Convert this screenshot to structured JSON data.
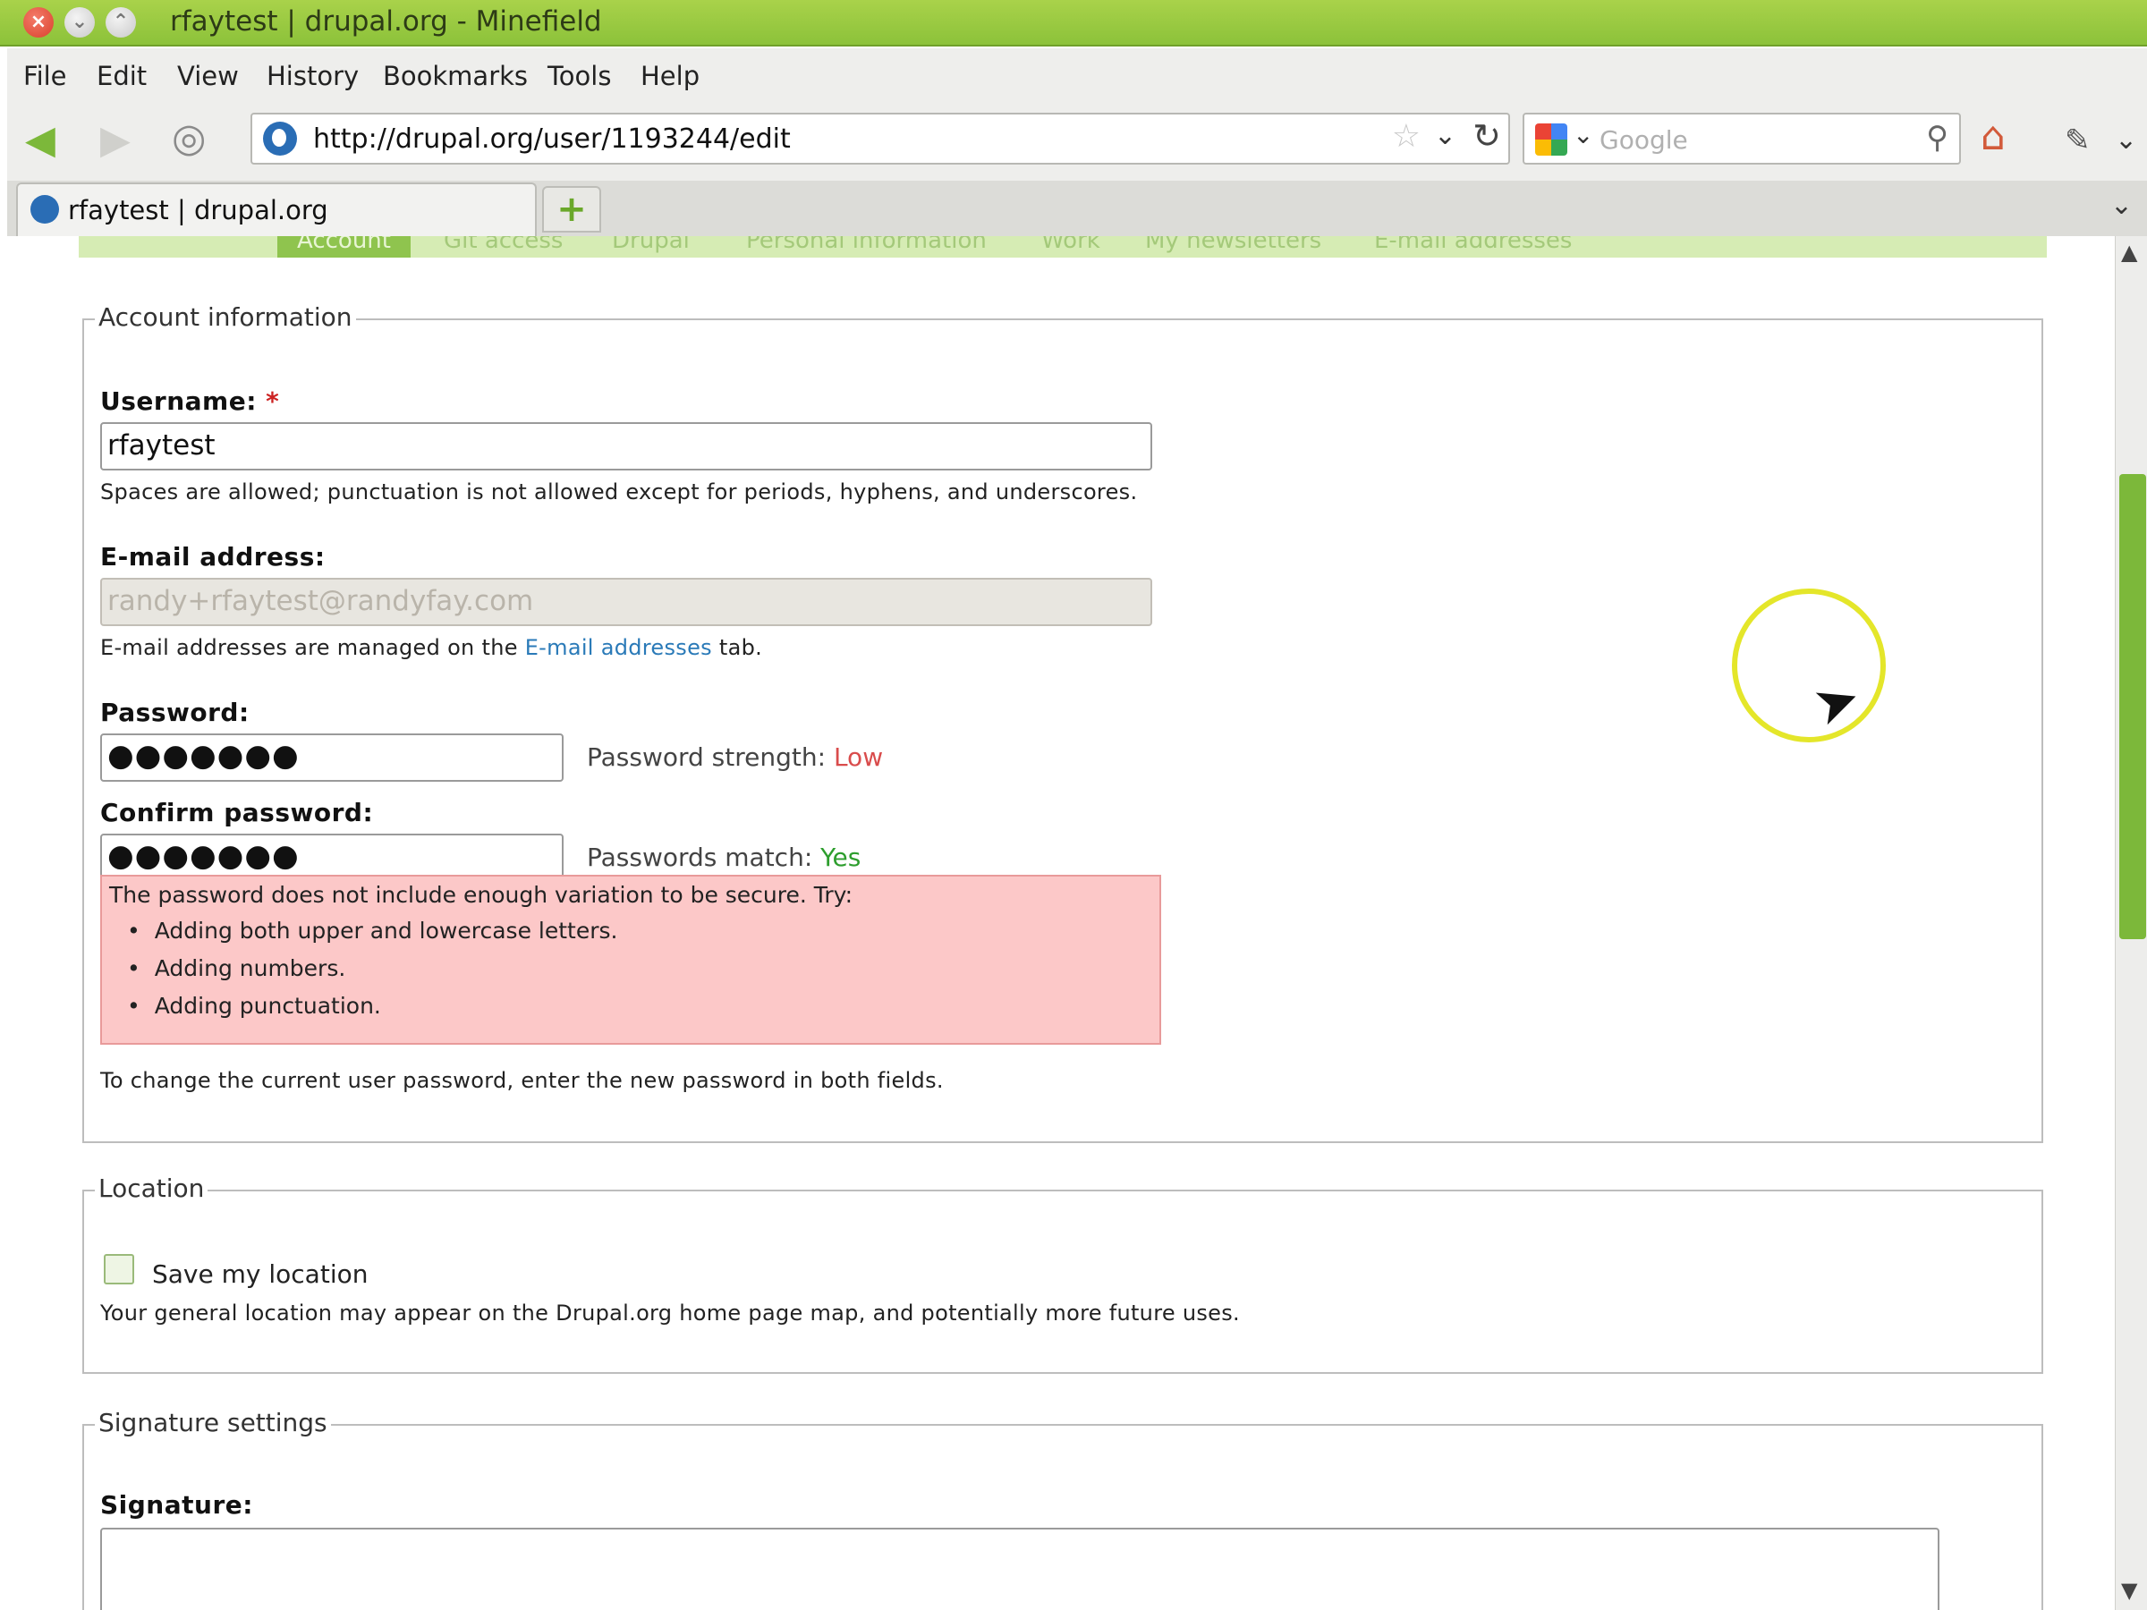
{
  "window": {
    "title": "rfaytest | drupal.org - Minefield",
    "close": "×",
    "minimize": "⌄",
    "maximize": "⌃"
  },
  "menu": [
    "File",
    "Edit",
    "View",
    "History",
    "Bookmarks",
    "Tools",
    "Help"
  ],
  "nav": {
    "url": "http://drupal.org/user/1193244/edit",
    "search_placeholder": "Google"
  },
  "tab": {
    "label": "rfaytest | drupal.org",
    "new_tab": "+"
  },
  "page_tabs": [
    "Account",
    "Git access",
    "Drupal",
    "Personal information",
    "Work",
    "My newsletters",
    "E-mail addresses"
  ],
  "account": {
    "legend": "Account information",
    "username_label": "Username:",
    "required_mark": "*",
    "username_value": "rfaytest",
    "username_desc": "Spaces are allowed; punctuation is not allowed except for periods, hyphens, and underscores.",
    "email_label": "E-mail address:",
    "email_value": "randy+rfaytest@randyfay.com",
    "email_desc_before": "E-mail addresses are managed on the ",
    "email_desc_link": "E-mail addresses",
    "email_desc_after": " tab.",
    "password_label": "Password:",
    "password_value": "●●●●●●●",
    "strength_label": "Password strength: ",
    "strength_value": "Low",
    "confirm_label": "Confirm password:",
    "confirm_value": "●●●●●●●",
    "match_label": "Passwords match: ",
    "match_value": "Yes",
    "warning_head": "The password does not include enough variation to be secure. Try:",
    "warning_items": [
      "Adding both upper and lowercase letters.",
      "Adding numbers.",
      "Adding punctuation."
    ],
    "password_desc": "To change the current user password, enter the new password in both fields."
  },
  "location": {
    "legend": "Location",
    "checkbox_label": "Save my location",
    "checked": false,
    "desc": "Your general location may appear on the Drupal.org home page map, and potentially more future uses."
  },
  "signature": {
    "legend": "Signature settings",
    "label": "Signature:"
  },
  "colors": {
    "titlebar": "#8cc23a",
    "accent": "#7cb83a",
    "link": "#2a7ab8",
    "error_bg": "#fcc8c8",
    "low": "#d94c4c",
    "yes": "#2e9e2e"
  }
}
